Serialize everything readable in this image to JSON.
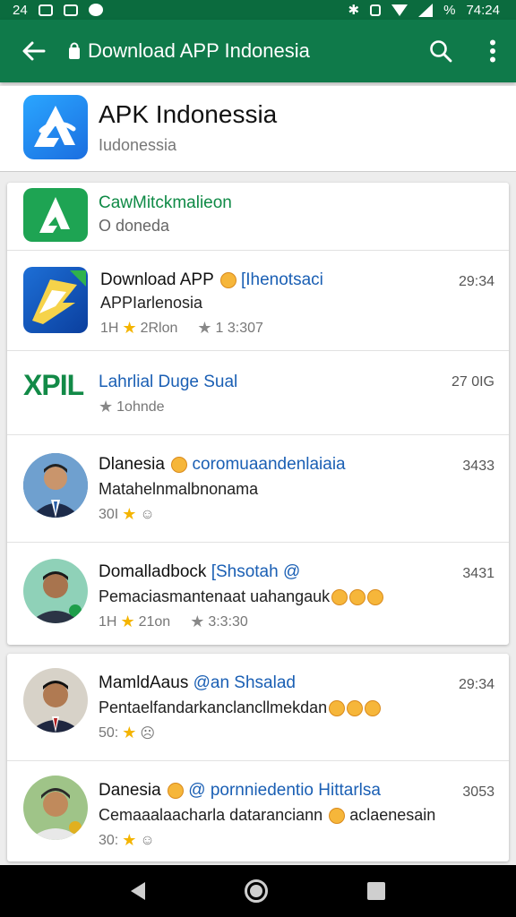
{
  "status_bar": {
    "left_text": "24",
    "right_text": "%",
    "time": "74:24"
  },
  "app_bar": {
    "title": "Download APP Indonesia"
  },
  "header": {
    "title": "APK Indonessia",
    "subtitle": "Iudonessia"
  },
  "rows": [
    {
      "title": "CawMitckmalieon",
      "line2": "O doneda"
    },
    {
      "title": "Download APP",
      "title_accent": "[Ihenotsaci",
      "line2": "APPIarlenosia",
      "rating": "1H",
      "downloads": "2Rlon",
      "size": "1 3:307",
      "time": "29:34"
    },
    {
      "logo_text": "XPIL",
      "title": "Lahrlial Duge Sual",
      "meta": "1ohnde",
      "time": "27 0IG"
    },
    {
      "title": "Dlanesia",
      "title_accent": "coromuaandenlaiaia",
      "line2": "Matahelnmalbnonama",
      "rating": "30I",
      "time": "3433"
    },
    {
      "title": "Domalladbock",
      "title_accent": "[Shsotah @",
      "line2": "Pemaciasmantenaat uahangauk",
      "rating": "1H",
      "downloads": "21on",
      "size": "3:3:30",
      "time": "3431"
    },
    {
      "title": "MamldAaus",
      "title_accent": "@an Shsalad",
      "line2": "Pentaelfandarkanclancllmekdan",
      "rating": "50:",
      "time": "29:34"
    },
    {
      "title": "Danesia",
      "title_accent": "@ pornniedentio Hittarlsa",
      "line2": "Cemaaalaacharla dataranciann",
      "line2_tail": "aclaenesain",
      "rating": "30:",
      "time": "3053"
    }
  ],
  "colors": {
    "primary": "#0f7a4a",
    "status": "#0b6b3e",
    "accent_text": "#1a5fb4",
    "star": "#f4b400"
  }
}
